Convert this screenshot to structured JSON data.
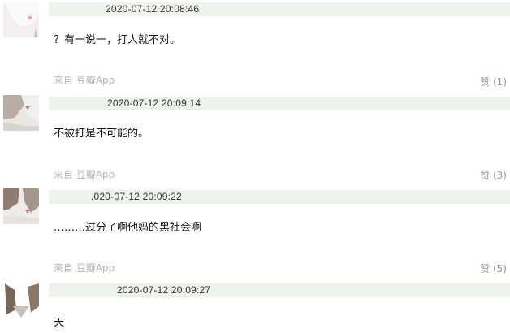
{
  "comments": [
    {
      "timestamp": "2020-07-12 20:08:46",
      "text": "？有一说一，打人就不对。",
      "source": "来自 豆瓣App",
      "likes": "赞 (1)",
      "avatar_icon": "user-avatar-icon"
    },
    {
      "timestamp": "2020-07-12 20:09:14",
      "text": "不被打是不可能的。",
      "source": "来自 豆瓣App",
      "likes": "赞 (3)",
      "avatar_icon": "user-avatar-icon"
    },
    {
      "timestamp": ".020-07-12 20:09:22",
      "text": "………过分了啊他妈的黑社会啊",
      "source": "来自 豆瓣App",
      "likes": "赞 (5)",
      "avatar_icon": "user-avatar-icon"
    },
    {
      "timestamp": "2020-07-12 20:09:27",
      "text": "天",
      "avatar_icon": "user-avatar-icon"
    }
  ],
  "colors": {
    "header_bg": "#eef3ec",
    "source_text": "#b5b5b5",
    "likes_text": "#999999"
  }
}
